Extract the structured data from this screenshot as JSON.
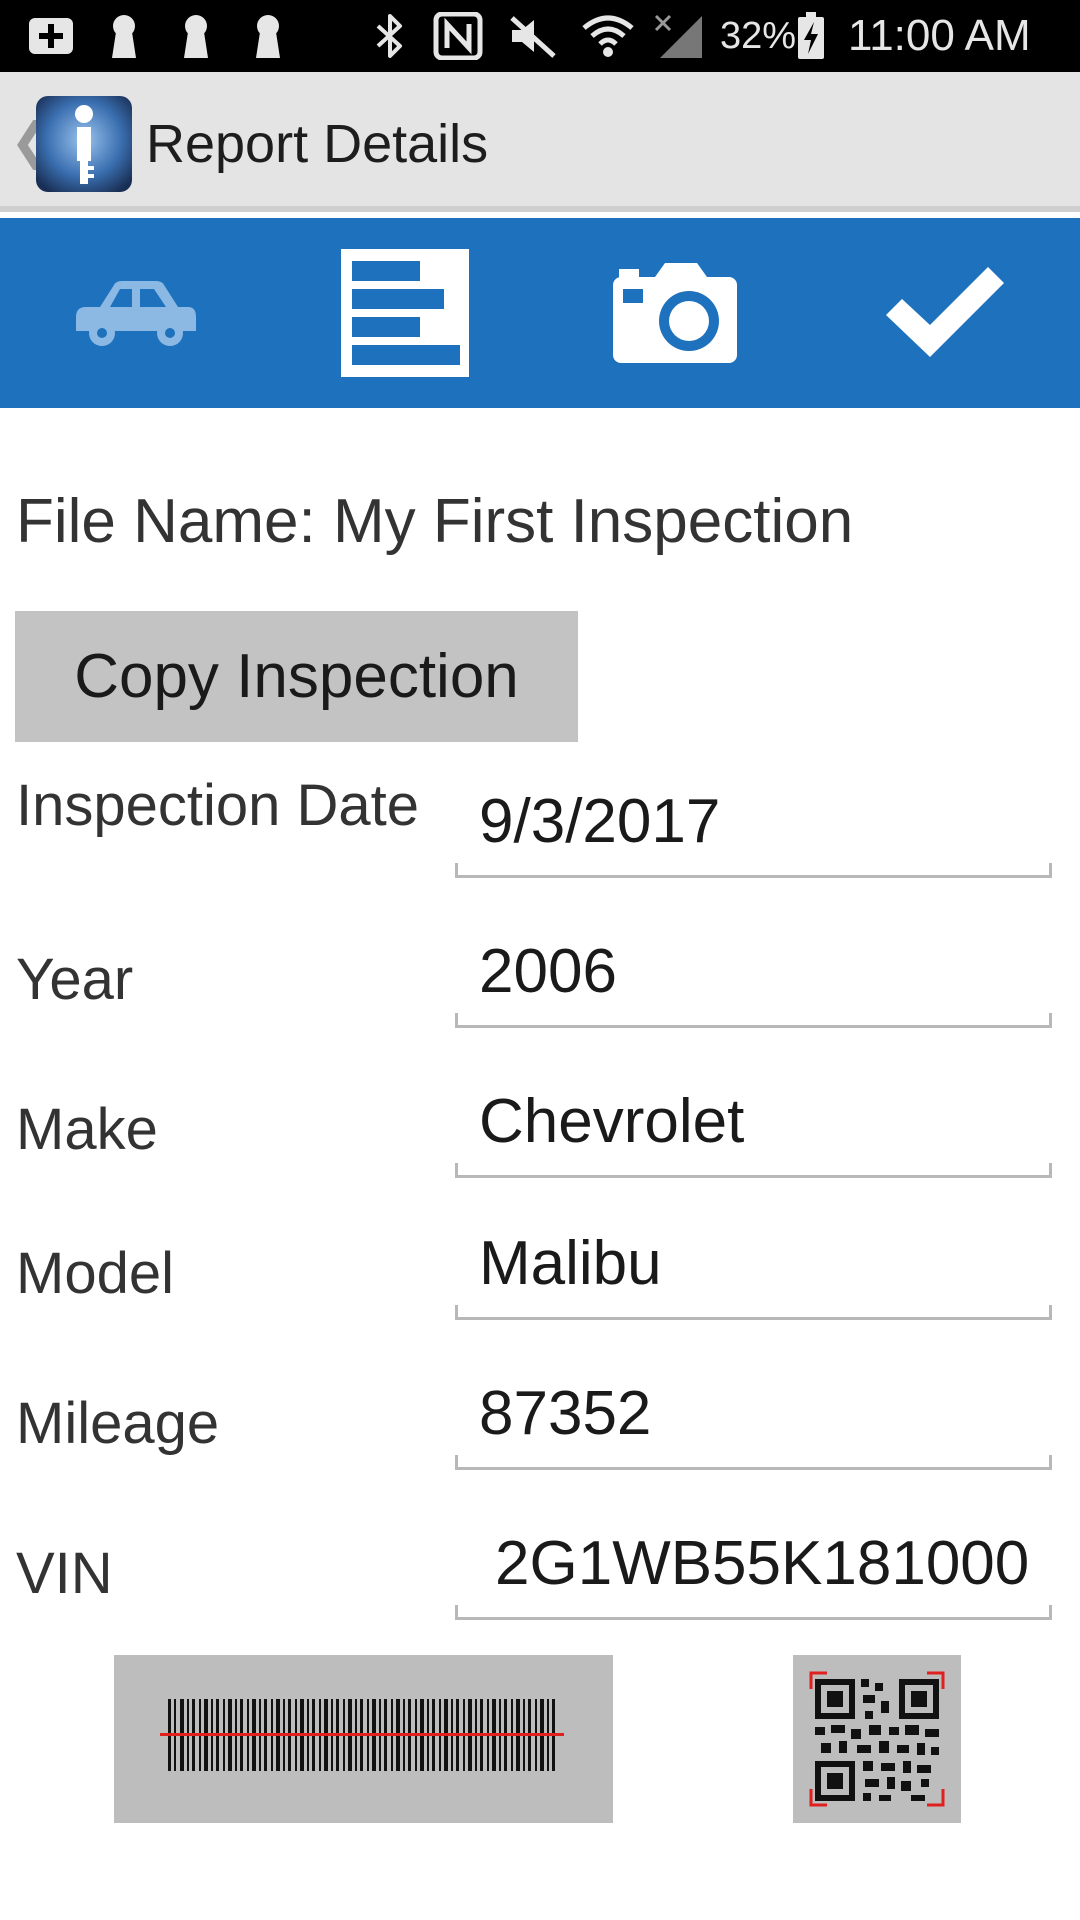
{
  "status_bar": {
    "battery_percent": "32%",
    "time": "11:00 AM",
    "icons": [
      "add-notification-icon",
      "keyhole-icon",
      "keyhole-icon",
      "keyhole-icon",
      "bluetooth-icon",
      "nfc-icon",
      "vibrate-mute-icon",
      "wifi-icon",
      "signal-icon",
      "battery-charging-icon"
    ]
  },
  "action_bar": {
    "back_icon": "chevron-left-icon",
    "app_icon": "info-key-app-icon",
    "title": "Report Details"
  },
  "toolbar": {
    "color": "#1e72bd",
    "tabs": [
      {
        "icon": "car-icon",
        "state": "inactive"
      },
      {
        "icon": "report-list-icon",
        "state": "active"
      },
      {
        "icon": "camera-icon",
        "state": "active"
      },
      {
        "icon": "checkmark-icon",
        "state": "active"
      }
    ]
  },
  "file": {
    "label_text": "File Name: My First Inspection"
  },
  "copy_button": {
    "label": "Copy Inspection"
  },
  "fields": [
    {
      "label": "Inspection Date",
      "value": "9/3/2017"
    },
    {
      "label": "Year",
      "value": "2006"
    },
    {
      "label": "Make",
      "value": "Chevrolet"
    },
    {
      "label": "Model",
      "value": "Malibu"
    },
    {
      "label": "Mileage",
      "value": "87352"
    },
    {
      "label": "VIN",
      "value": "2G1WB55K181000"
    }
  ],
  "scanners": [
    {
      "icon": "barcode-scan-icon"
    },
    {
      "icon": "qr-scan-icon"
    }
  ]
}
